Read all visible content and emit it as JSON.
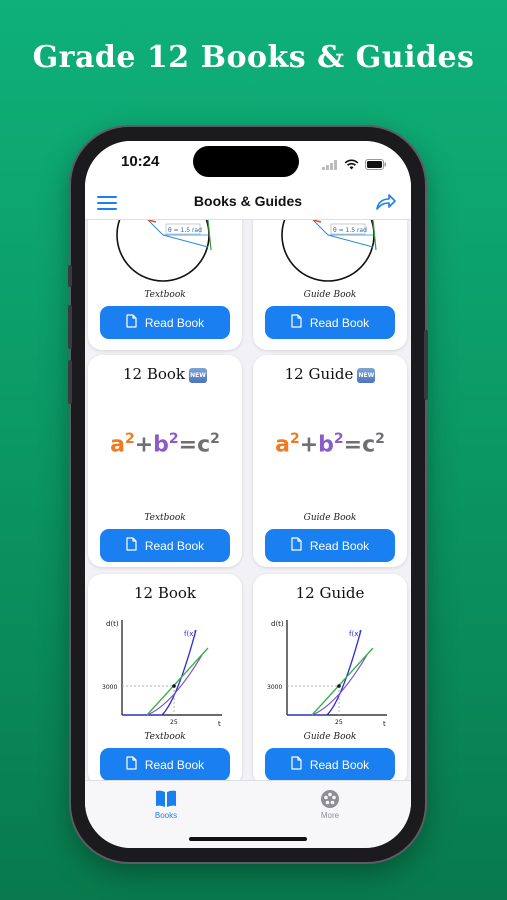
{
  "headline": "Grade 12 Books & Guides",
  "status_bar": {
    "time": "10:24"
  },
  "nav": {
    "title": "Books & Guides"
  },
  "cards": [
    {
      "title": "",
      "subtitle": "Textbook",
      "button_label": "Read Book",
      "illustration": "circle-radian",
      "label": "θ = 1.5 rad"
    },
    {
      "title": "",
      "subtitle": "Guide Book",
      "button_label": "Read Book",
      "illustration": "circle-radian",
      "label": "θ = 1.5 rad"
    },
    {
      "title": "12 Book",
      "badge": "NEW",
      "subtitle": "Textbook",
      "button_label": "Read Book",
      "illustration": "pythagoras"
    },
    {
      "title": "12 Guide",
      "badge": "NEW",
      "subtitle": "Guide Book",
      "button_label": "Read Book",
      "illustration": "pythagoras"
    },
    {
      "title": "12 Book",
      "subtitle": "Textbook",
      "button_label": "Read Book",
      "illustration": "graph"
    },
    {
      "title": "12 Guide",
      "subtitle": "Guide Book",
      "button_label": "Read Book",
      "illustration": "graph"
    }
  ],
  "formula": {
    "a": "a",
    "b": "b",
    "c": "c",
    "exp": "2",
    "plus": "+",
    "eq": "="
  },
  "graph": {
    "ylabel": "d(t)",
    "xlabel": "t",
    "curve_label": "f(x)",
    "y_tick": "3000",
    "x_tick": "25"
  },
  "tabs": [
    {
      "label": "Books",
      "icon": "book-icon",
      "active": true
    },
    {
      "label": "More",
      "icon": "more-icon",
      "active": false
    }
  ],
  "colors": {
    "background": "#0fa873",
    "accent": "#1a7ff0",
    "formula_a": "#f07a1e",
    "formula_b": "#8a5bc9",
    "formula_c": "#6e6e73"
  }
}
